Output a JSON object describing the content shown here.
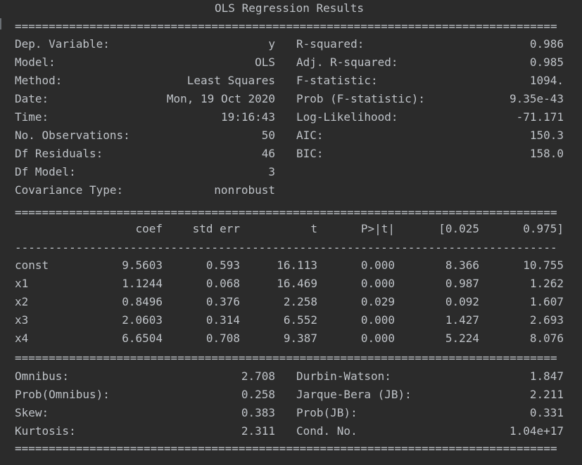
{
  "title": "OLS Regression Results",
  "separators": {
    "double": "================================================================================",
    "single": "--------------------------------------------------------------------------------"
  },
  "summary": {
    "left": [
      {
        "label": "Dep. Variable:",
        "value": "y"
      },
      {
        "label": "Model:",
        "value": "OLS"
      },
      {
        "label": "Method:",
        "value": "Least Squares"
      },
      {
        "label": "Date:",
        "value": "Mon, 19 Oct 2020"
      },
      {
        "label": "Time:",
        "value": "19:16:43"
      },
      {
        "label": "No. Observations:",
        "value": "50"
      },
      {
        "label": "Df Residuals:",
        "value": "46"
      },
      {
        "label": "Df Model:",
        "value": "3"
      },
      {
        "label": "Covariance Type:",
        "value": "nonrobust"
      }
    ],
    "right": [
      {
        "label": "R-squared:",
        "value": "0.986"
      },
      {
        "label": "Adj. R-squared:",
        "value": "0.985"
      },
      {
        "label": "F-statistic:",
        "value": "1094."
      },
      {
        "label": "Prob (F-statistic):",
        "value": "9.35e-43"
      },
      {
        "label": "Log-Likelihood:",
        "value": "-71.171"
      },
      {
        "label": "AIC:",
        "value": "150.3"
      },
      {
        "label": "BIC:",
        "value": "158.0"
      }
    ]
  },
  "coef_table": {
    "headers": [
      "",
      "coef",
      "std err",
      "t",
      "P>|t|",
      "[0.025",
      "0.975]"
    ],
    "rows": [
      [
        "const",
        "9.5603",
        "0.593",
        "16.113",
        "0.000",
        "8.366",
        "10.755"
      ],
      [
        "x1",
        "1.1244",
        "0.068",
        "16.469",
        "0.000",
        "0.987",
        "1.262"
      ],
      [
        "x2",
        "0.8496",
        "0.376",
        "2.258",
        "0.029",
        "0.092",
        "1.607"
      ],
      [
        "x3",
        "2.0603",
        "0.314",
        "6.552",
        "0.000",
        "1.427",
        "2.693"
      ],
      [
        "x4",
        "6.6504",
        "0.708",
        "9.387",
        "0.000",
        "5.224",
        "8.076"
      ]
    ]
  },
  "diagnostics": {
    "left": [
      {
        "label": "Omnibus:",
        "value": "2.708"
      },
      {
        "label": "Prob(Omnibus):",
        "value": "0.258"
      },
      {
        "label": "Skew:",
        "value": "0.383"
      },
      {
        "label": "Kurtosis:",
        "value": "2.311"
      }
    ],
    "right": [
      {
        "label": "Durbin-Watson:",
        "value": "1.847"
      },
      {
        "label": "Jarque-Bera (JB):",
        "value": "2.211"
      },
      {
        "label": "Prob(JB):",
        "value": "0.331"
      },
      {
        "label": "Cond. No.",
        "value": "1.04e+17"
      }
    ]
  },
  "colors": {
    "background": "#2b2b2b",
    "text": "#bfc3c8"
  }
}
